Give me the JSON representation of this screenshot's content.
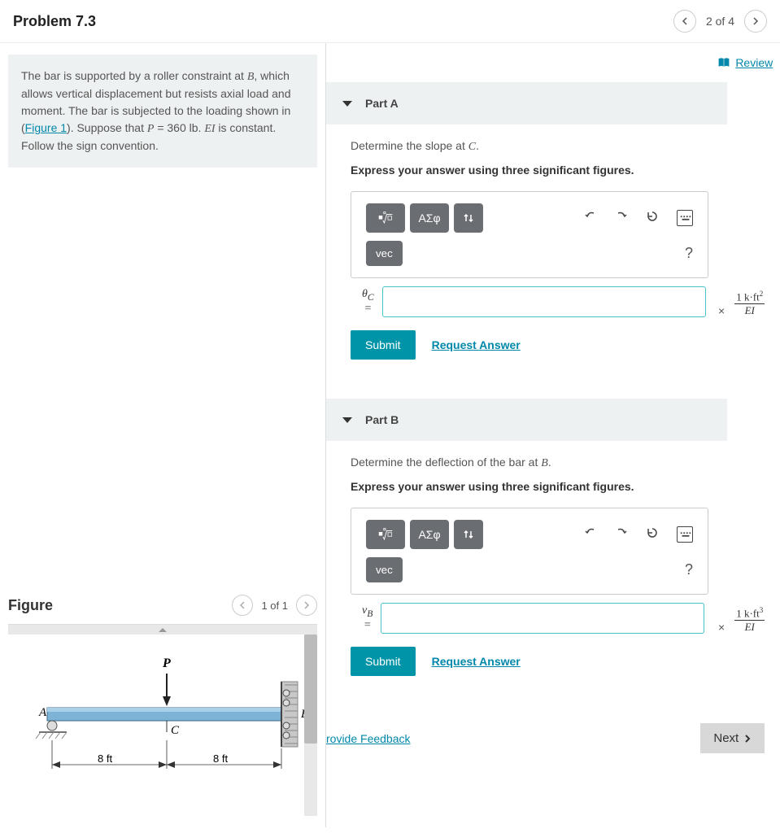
{
  "header": {
    "title": "Problem 7.3",
    "page_counter": "2 of 4"
  },
  "problem": {
    "text_1": "The bar is supported by a roller constraint at ",
    "var_B": "B",
    "text_2": ", which allows vertical displacement but resists axial load and moment. The bar is subjected to the loading shown in (",
    "figure_link": "Figure 1",
    "text_3": "). Suppose that ",
    "var_P": "P",
    "eq": " = 360 ",
    "unit_lb": "lb",
    "text_4": ". ",
    "var_EI": "EI",
    "text_5": " is constant. Follow the sign convention."
  },
  "figure": {
    "title": "Figure",
    "counter": "1 of 1",
    "label_P": "P",
    "label_A": "A",
    "label_B": "B",
    "label_C": "C",
    "dim_left": "8 ft",
    "dim_right": "8 ft"
  },
  "review_link": "Review",
  "parts": {
    "a": {
      "title": "Part A",
      "question_pre": "Determine the slope at ",
      "question_var": "C",
      "question_post": ".",
      "instruction": "Express your answer using three significant figures.",
      "toolbar": {
        "greek": "ΑΣφ",
        "vec": "vec",
        "help": "?"
      },
      "var_label": "θ",
      "var_sub": "C",
      "eq": "=",
      "times": "×",
      "unit_num": "1 k·ft",
      "unit_exp": "2",
      "unit_den": "EI",
      "submit": "Submit",
      "request": "Request Answer"
    },
    "b": {
      "title": "Part B",
      "question_pre": "Determine the deflection of the bar at ",
      "question_var": "B",
      "question_post": ".",
      "instruction": "Express your answer using three significant figures.",
      "toolbar": {
        "greek": "ΑΣφ",
        "vec": "vec",
        "help": "?"
      },
      "var_label": "v",
      "var_sub": "B",
      "eq": "=",
      "times": "×",
      "unit_num": "1 k·ft",
      "unit_exp": "3",
      "unit_den": "EI",
      "submit": "Submit",
      "request": "Request Answer"
    }
  },
  "footer": {
    "feedback": "rovide Feedback",
    "next": "Next"
  }
}
